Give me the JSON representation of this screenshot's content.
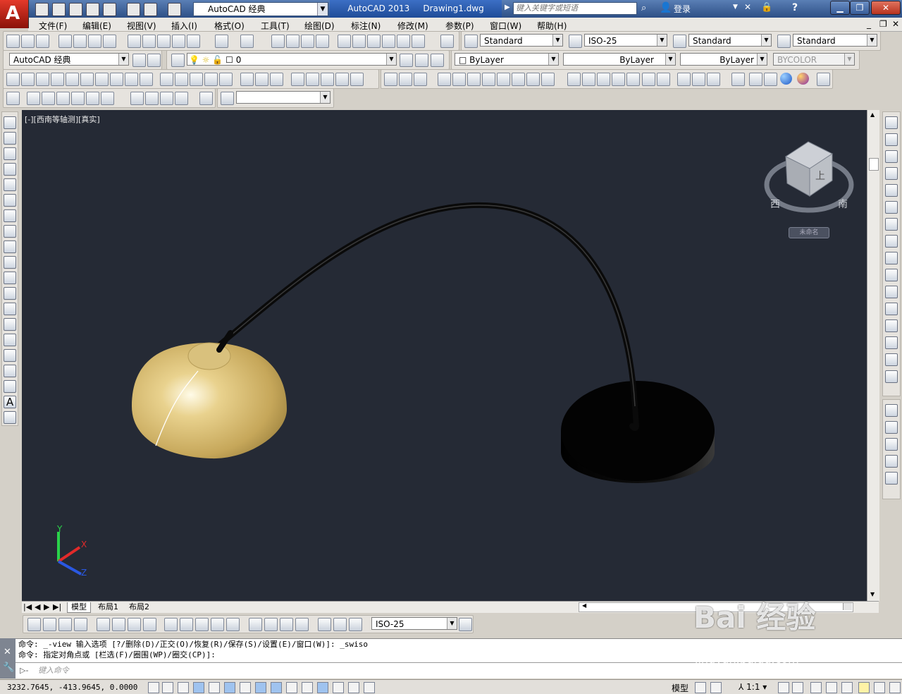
{
  "titlebar": {
    "logo_letter": "A",
    "workspace": "AutoCAD 经典",
    "app_title": "AutoCAD 2013",
    "file_name": "Drawing1.dwg",
    "search_placeholder": "键入关键字或短语",
    "login": "登录"
  },
  "menu": [
    "文件(F)",
    "编辑(E)",
    "视图(V)",
    "插入(I)",
    "格式(O)",
    "工具(T)",
    "绘图(D)",
    "标注(N)",
    "修改(M)",
    "参数(P)",
    "窗口(W)",
    "帮助(H)"
  ],
  "styles": {
    "text_style": "Standard",
    "dim_style": "ISO-25",
    "table_style": "Standard",
    "mleader_style": "Standard"
  },
  "layers": {
    "workspace2": "AutoCAD 经典",
    "current_layer": "0",
    "color": "ByLayer",
    "linetype": "ByLayer",
    "lineweight": "ByLayer",
    "plotstyle": "BYCOLOR"
  },
  "viewport": {
    "label": "[-][西南等轴测][真实]",
    "unnamed_ucs": "未命名",
    "viewcube_face": "上",
    "compass_w": "西",
    "compass_s": "南",
    "axis_x": "X",
    "axis_y": "Y",
    "axis_z": "Z",
    "lamp_shade_color": "#d4b76a",
    "base_color": "#050505"
  },
  "tabs": [
    "模型",
    "布局1",
    "布局2"
  ],
  "dim_toolbar": {
    "dim_style": "ISO-25"
  },
  "command_history": [
    "命令: _-view 输入选项 [?/删除(D)/正交(O)/恢复(R)/保存(S)/设置(E)/窗口(W)]: _swiso",
    "命令: 指定对角点或 [栏选(F)/圈围(WP)/圈交(CP)]:"
  ],
  "command_prompt": "键入命令",
  "status": {
    "coordinates": "3232.7645, -413.9645, 0.0000",
    "model": "模型",
    "scale": "1:1"
  },
  "watermark": {
    "brand": "Bai 经验",
    "url": "jingyan.baidu.com"
  }
}
